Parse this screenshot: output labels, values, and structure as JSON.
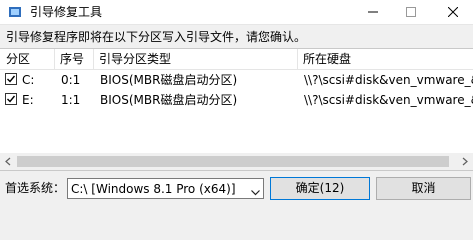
{
  "window": {
    "title": "引导修复工具"
  },
  "hint": "引导修复程序即将在以下分区写入引导文件，请您确认。",
  "table": {
    "columns": [
      "分区",
      "序号",
      "引导分区类型",
      "所在硬盘"
    ],
    "rows": [
      {
        "checked": true,
        "partition": "C:",
        "index": "0:1",
        "type": "BIOS(MBR磁盘启动分区)",
        "disk": "\\\\?\\scsi#disk&ven_vmware_&"
      },
      {
        "checked": true,
        "partition": "E:",
        "index": "1:1",
        "type": "BIOS(MBR磁盘启动分区)",
        "disk": "\\\\?\\scsi#disk&ven_vmware_&"
      }
    ]
  },
  "footer": {
    "boot_label": "首选系统：",
    "boot_select_value": "C:\\ [Windows 8.1 Pro (x64)]",
    "ok_label": "确定(12)",
    "cancel_label": "取消"
  }
}
